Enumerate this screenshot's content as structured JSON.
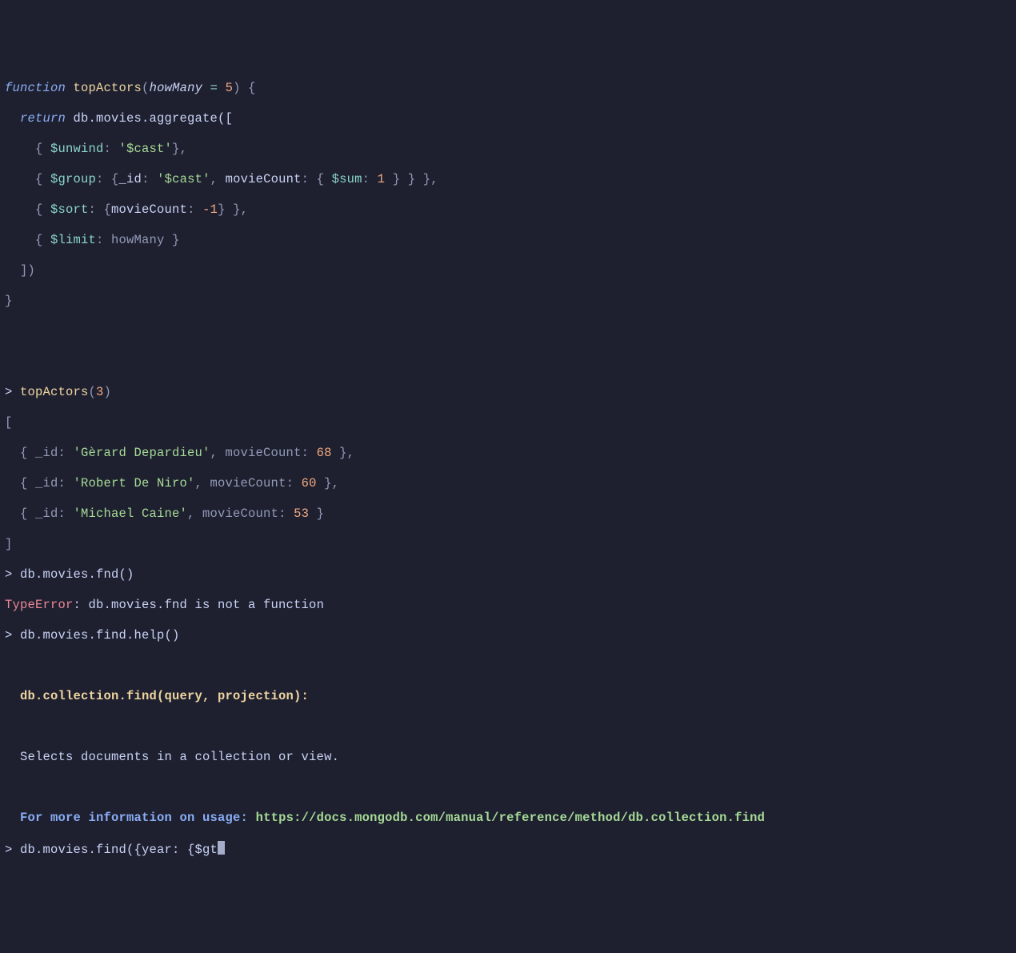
{
  "code": {
    "l1_kw": "function",
    "l1_fn": "topActors",
    "l1_open": "(",
    "l1_param": "howMany",
    "l1_eq": " = ",
    "l1_default": "5",
    "l1_close": ") {",
    "l2_kw": "  return",
    "l2_rest": " db.movies.aggregate([",
    "l3_a": "    { ",
    "l3_op": "$unwind",
    "l3_b": ": ",
    "l3_str": "'$cast'",
    "l3_c": "},",
    "l4_a": "    { ",
    "l4_op": "$group",
    "l4_b": ": {",
    "l4_id": "_id",
    "l4_c": ": ",
    "l4_str": "'$cast'",
    "l4_d": ", ",
    "l4_mc": "movieCount",
    "l4_e": ": { ",
    "l4_sum": "$sum",
    "l4_f": ": ",
    "l4_one": "1",
    "l4_g": " } } },",
    "l5_a": "    { ",
    "l5_op": "$sort",
    "l5_b": ": {",
    "l5_mc": "movieCount",
    "l5_c": ": ",
    "l5_neg": "-1",
    "l5_d": "} },",
    "l6_a": "    { ",
    "l6_op": "$limit",
    "l6_b": ": howMany }",
    "l7": "  ])",
    "l8": "}"
  },
  "call": {
    "prompt": "> ",
    "fn": "topActors",
    "open": "(",
    "arg": "3",
    "close": ")"
  },
  "result": {
    "open": "[",
    "r1_a": "  { _id: ",
    "r1_name": "'Gèrard Depardieu'",
    "r1_b": ", movieCount: ",
    "r1_n": "68",
    "r1_c": " },",
    "r2_a": "  { _id: ",
    "r2_name": "'Robert De Niro'",
    "r2_b": ", movieCount: ",
    "r2_n": "60",
    "r2_c": " },",
    "r3_a": "  { _id: ",
    "r3_name": "'Michael Caine'",
    "r3_b": ", movieCount: ",
    "r3_n": "53",
    "r3_c": " }",
    "close": "]"
  },
  "fnd": {
    "prompt": "> ",
    "cmd": "db.movies.fnd()",
    "err_type": "TypeError",
    "err_msg": ": db.movies.fnd is not a function"
  },
  "help": {
    "prompt": "> ",
    "cmd": "db.movies.find.help()",
    "sig": "  db.collection.find(query, projection):",
    "desc": "  Selects documents in a collection or view.",
    "more_label": "  For more information on usage: ",
    "url": "https://docs.mongodb.com/manual/reference/method/db.collection.find"
  },
  "input": {
    "prompt": "> ",
    "typed": "db.movies.find({year: {$gt"
  }
}
